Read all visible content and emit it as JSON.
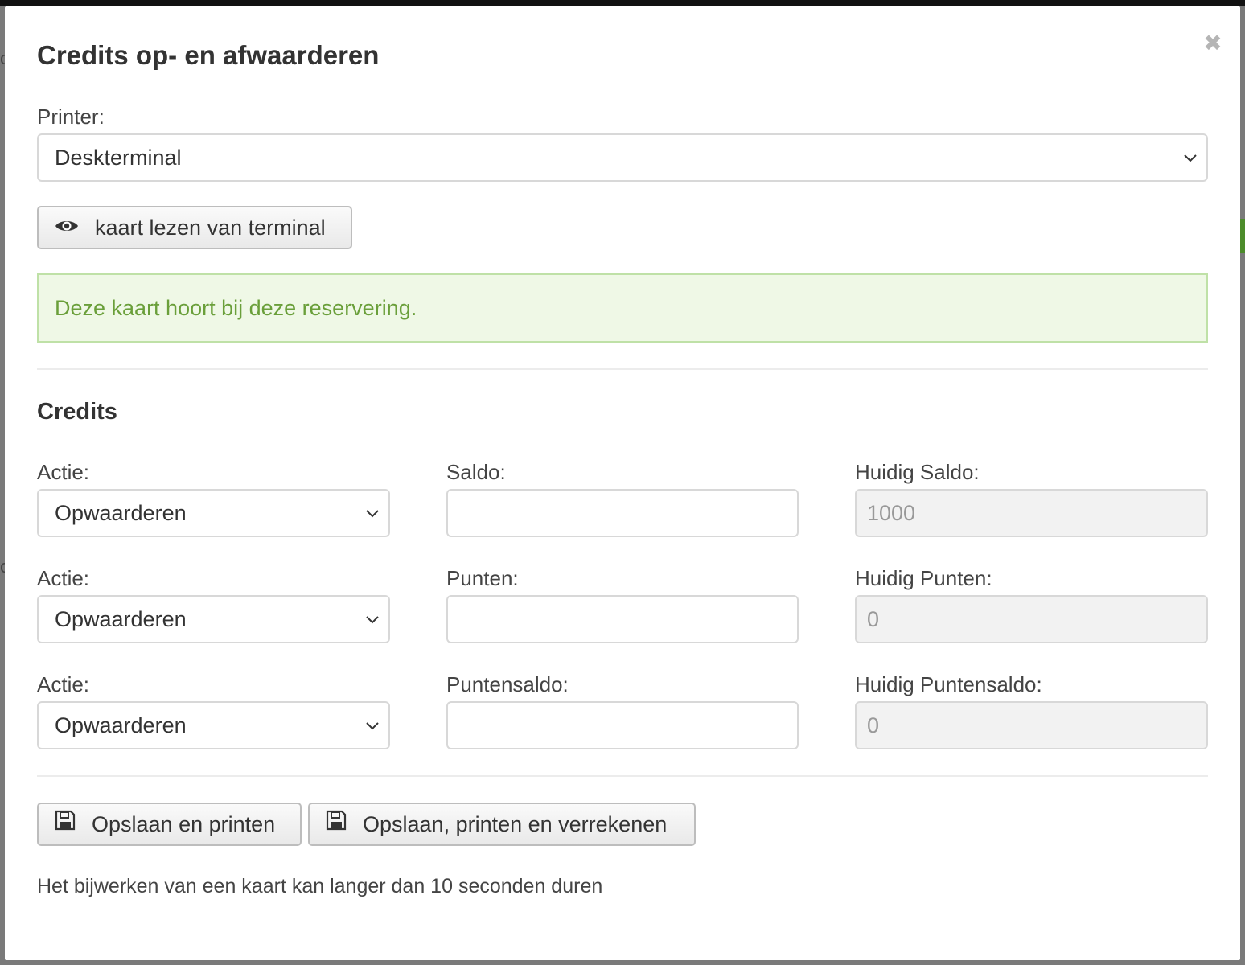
{
  "dialog": {
    "title": "Credits op- en afwaarderen",
    "close_glyph": "✖"
  },
  "printer": {
    "label": "Printer:",
    "selected": "Deskterminal"
  },
  "read_card_button": {
    "label": "kaart lezen van terminal",
    "icon": "eye-icon"
  },
  "alert": {
    "message": "Deze kaart hoort bij deze reservering."
  },
  "credits": {
    "heading": "Credits",
    "rows": [
      {
        "action_label": "Actie:",
        "action_value": "Opwaarderen",
        "amount_label": "Saldo:",
        "amount_value": "",
        "current_label": "Huidig Saldo:",
        "current_value": "1000"
      },
      {
        "action_label": "Actie:",
        "action_value": "Opwaarderen",
        "amount_label": "Punten:",
        "amount_value": "",
        "current_label": "Huidig Punten:",
        "current_value": "0"
      },
      {
        "action_label": "Actie:",
        "action_value": "Opwaarderen",
        "amount_label": "Puntensaldo:",
        "amount_value": "",
        "current_label": "Huidig Puntensaldo:",
        "current_value": "0"
      }
    ]
  },
  "actions": {
    "save_print": {
      "label": "Opslaan en printen",
      "icon": "floppy-icon"
    },
    "save_print_settle": {
      "label": "Opslaan, printen en verrekenen",
      "icon": "floppy-icon"
    }
  },
  "footer_note": "Het bijwerken van een kaart kan langer dan 10 seconden duren",
  "colors": {
    "alert_bg": "#eff8e6",
    "alert_text": "#6a9f3a",
    "alert_border": "#bfe1a7"
  }
}
